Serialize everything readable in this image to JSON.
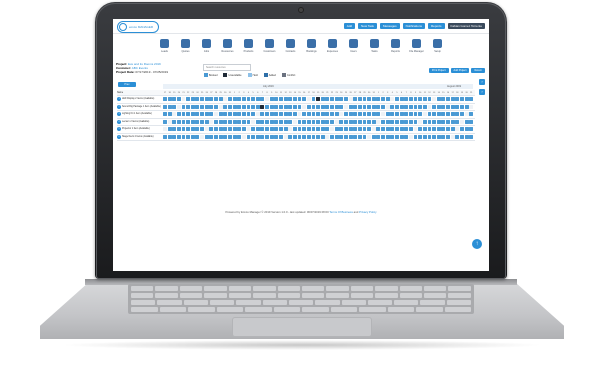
{
  "topbar": {
    "logo_text": "emvio MANAGER",
    "buttons": [
      "Add",
      "New Task",
      "Messages",
      "Notifications",
      "Reports",
      "Fabian Gomez Torrente"
    ]
  },
  "modules": [
    "Leads",
    "Quotes",
    "Jobs",
    "Resources",
    "Products",
    "Customers",
    "Contacts",
    "Bookings",
    "Expenses",
    "Users",
    "Tasks",
    "Reports",
    "File Manager",
    "Setup"
  ],
  "project": {
    "line1_label": "Project:",
    "line1_value": "Eve and its Rooms 2019",
    "line2_label": "Customer:",
    "line2_value": "ABC Events",
    "line3_label": "Project Date:",
    "line3_value": "07/17/2019 - 07/25/2019"
  },
  "search_placeholder": "Search resources",
  "legend": [
    "Booked",
    "Unavailable",
    "Held",
    "Added",
    "Conflict"
  ],
  "right_buttons": [
    "Print Project",
    "Add Project",
    "Return"
  ],
  "prev_label": "Prev",
  "months": [
    "July 2019",
    "August 2019"
  ],
  "grid_header_label": "Name",
  "days": [
    "17",
    "18",
    "19",
    "20",
    "21",
    "22",
    "23",
    "24",
    "25",
    "26",
    "27",
    "28",
    "29",
    "30",
    "31",
    "1",
    "2",
    "3",
    "4",
    "5",
    "6",
    "7",
    "8",
    "9",
    "10",
    "11",
    "12",
    "13",
    "14",
    "15",
    "16",
    "17",
    "18",
    "19",
    "20",
    "21",
    "22",
    "23",
    "24",
    "25",
    "26",
    "27",
    "28",
    "29",
    "30",
    "31",
    "1",
    "2",
    "3",
    "4",
    "5",
    "6",
    "7",
    "8",
    "9",
    "10",
    "11",
    "12",
    "13",
    "14",
    "15",
    "16",
    "17",
    "18",
    "19",
    "20",
    "21"
  ],
  "rows": [
    {
      "num": "1",
      "name": "LED Display",
      "sub": "2 Items (Available)"
    },
    {
      "num": "2",
      "name": "Sound Rig Package",
      "sub": "1 Item (Available)"
    },
    {
      "num": "3",
      "name": "Lighting Kit",
      "sub": "1 Item (Available)"
    },
    {
      "num": "4",
      "name": "Lectern",
      "sub": "2 Items (Available)"
    },
    {
      "num": "5",
      "name": "Projector",
      "sub": "1 Item (Available)"
    },
    {
      "num": "6",
      "name": "Stage Deck",
      "sub": "4 Items (Available)"
    }
  ],
  "footer": {
    "text": "Powered by Emvio Manager © 2019 Version 1.0.0 - last updated: 06/07/2019 08:00",
    "link1": "Terms Of Business",
    "and": "and",
    "link2": "Privacy Policy"
  },
  "colors": {
    "accent": "#2b8fd6",
    "booked": "#4a9ad4",
    "dark": "#1f2a36",
    "empty": "#eef2f6"
  }
}
